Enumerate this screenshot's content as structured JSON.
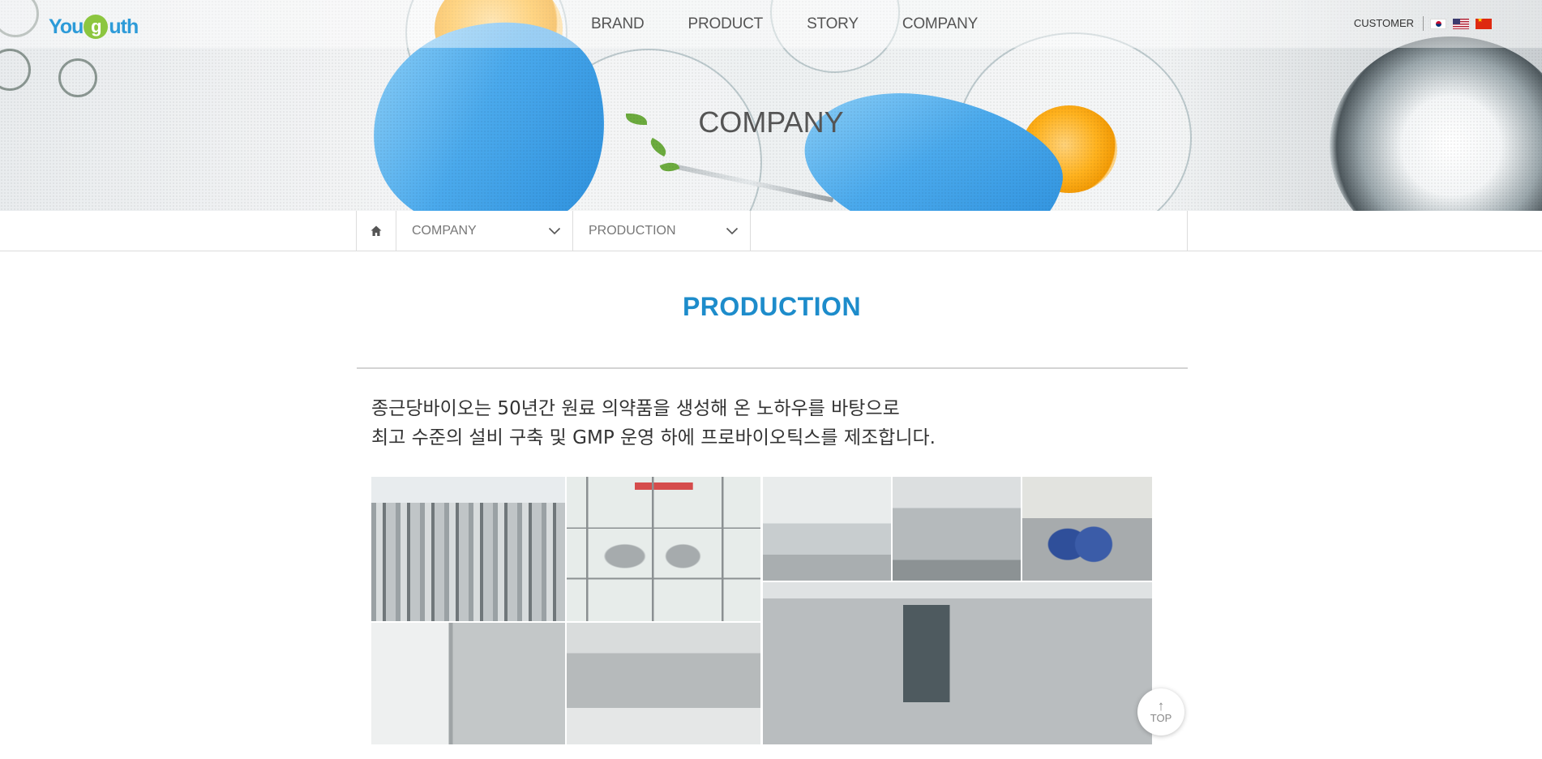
{
  "header": {
    "logo": {
      "part1": "You",
      "part2": "g",
      "part3": "uth"
    },
    "nav": [
      "BRAND",
      "PRODUCT",
      "STORY",
      "COMPANY"
    ],
    "util": {
      "customer": "CUSTOMER",
      "flags": [
        "flag-korea-icon",
        "flag-usa-icon",
        "flag-china-icon"
      ]
    }
  },
  "hero": {
    "title": "COMPANY"
  },
  "breadcrumb": {
    "home_icon": "home-icon",
    "level1": "COMPANY",
    "level2": "PRODUCTION"
  },
  "main": {
    "heading": "PRODUCTION",
    "intro": [
      "종근당바이오는 50년간 원료 의약품을 생성해 온 노하우를 바탕으로",
      "최고 수준의 설비 구축 및 GMP 운영 하에 프로바이오틱스를 제조합니다."
    ]
  },
  "top_button": {
    "label": "TOP",
    "icon": "arrow-up-icon"
  },
  "colors": {
    "accent": "#1d8ccb",
    "logo_blue": "#2d9bd8",
    "logo_green": "#8cc63f"
  }
}
